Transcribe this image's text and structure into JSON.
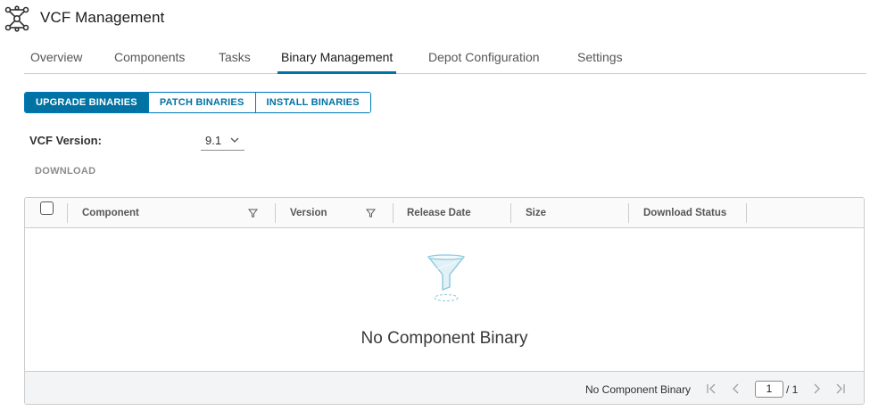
{
  "header": {
    "title": "VCF Management",
    "icon": "network-hub-icon"
  },
  "tabs": [
    {
      "label": "Overview",
      "active": false
    },
    {
      "label": "Components",
      "active": false
    },
    {
      "label": "Tasks",
      "active": false
    },
    {
      "label": "Binary Management",
      "active": true
    },
    {
      "label": "Depot Configuration",
      "active": false
    },
    {
      "label": "Settings",
      "active": false
    }
  ],
  "binary_tabs": [
    {
      "label": "UPGRADE BINARIES",
      "active": true
    },
    {
      "label": "PATCH BINARIES",
      "active": false
    },
    {
      "label": "INSTALL BINARIES",
      "active": false
    }
  ],
  "vcf_version": {
    "label": "VCF Version:",
    "value": "9.1"
  },
  "actions": {
    "download": "DOWNLOAD"
  },
  "grid": {
    "columns": [
      "Component",
      "Version",
      "Release Date",
      "Size",
      "Download Status"
    ],
    "empty_message": "No Component Binary",
    "footer": {
      "status": "No Component Binary",
      "page": "1",
      "total": "/ 1"
    }
  },
  "colors": {
    "accent": "#0072a3",
    "border": "#cccccc",
    "text": "#313131"
  }
}
